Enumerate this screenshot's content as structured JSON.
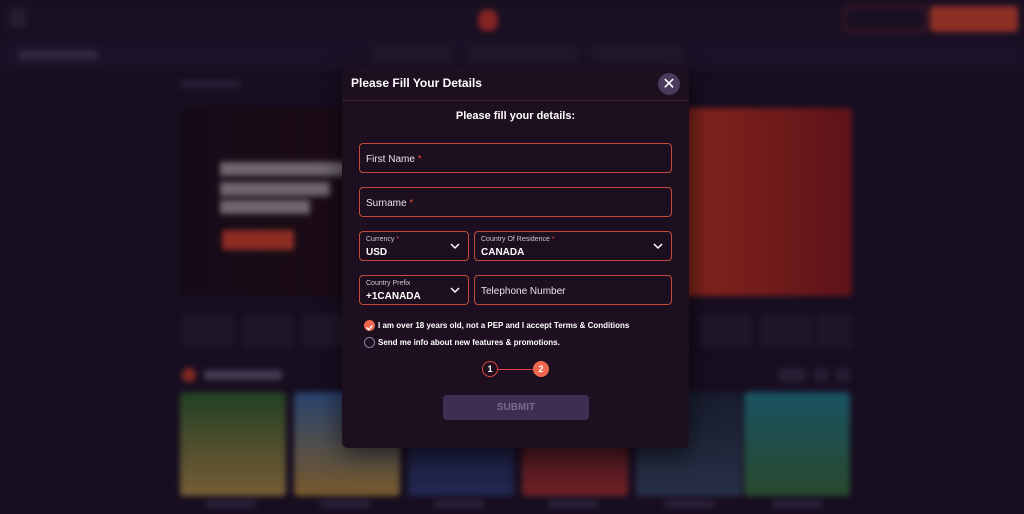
{
  "modal": {
    "title": "Please Fill Your Details",
    "close_icon": "close-icon",
    "subtitle": "Please fill your details:"
  },
  "form": {
    "first_name": {
      "placeholder": "First Name",
      "required_mark": "*"
    },
    "surname": {
      "placeholder": "Surname",
      "required_mark": "*"
    },
    "currency": {
      "label": "Currency",
      "required_mark": "*",
      "value": "USD"
    },
    "country": {
      "label": "Country Of Residence",
      "required_mark": "*",
      "value": "CANADA"
    },
    "prefix": {
      "label": "Country Prefix",
      "value": "+1CANADA"
    },
    "telephone": {
      "placeholder": "Telephone Number"
    }
  },
  "checkboxes": [
    {
      "label": "I am over 18 years old, not a PEP and I accept Terms & Conditions",
      "checked": true
    },
    {
      "label": "Send me info about new features & promotions.",
      "checked": false
    }
  ],
  "steps": [
    "1",
    "2"
  ],
  "submit_label": "SUBMIT",
  "colors": {
    "accent": "#f0674e",
    "field_border": "#c24c3c",
    "modal_bg": "#1d0f1f",
    "page_bg": "#1b1124"
  }
}
